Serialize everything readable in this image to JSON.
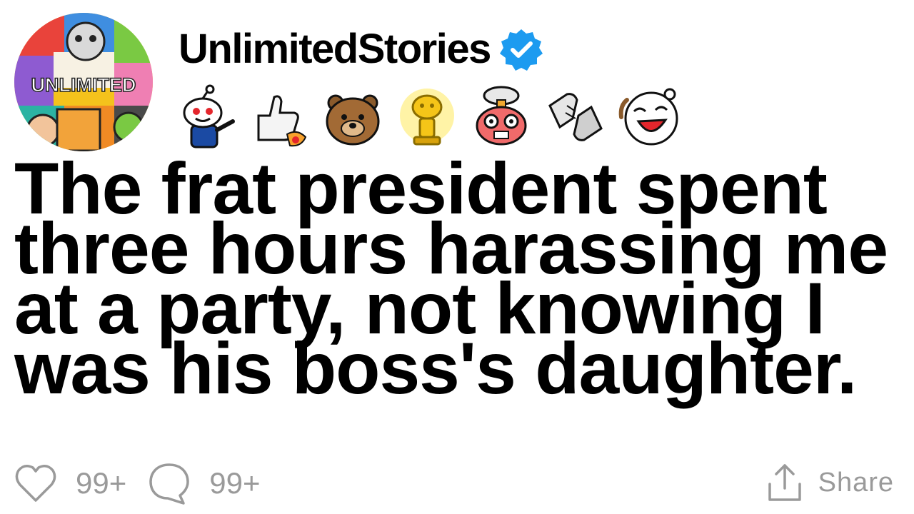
{
  "post": {
    "avatar_text": "UNLIMITED",
    "username": "UnlimitedStories",
    "verified_icon": "verified-check-icon",
    "awards": [
      {
        "icon": "reddit-alien-pointing-icon"
      },
      {
        "icon": "thumbs-up-rocket-icon"
      },
      {
        "icon": "bear-face-icon"
      },
      {
        "icon": "gold-trophy-icon"
      },
      {
        "icon": "mind-blown-icon"
      },
      {
        "icon": "handshake-icon"
      },
      {
        "icon": "laughing-face-icon"
      }
    ],
    "headline": "The frat president spent three hours harassing me at a party, not knowing I was his boss's daughter."
  },
  "actions": {
    "like_count": "99+",
    "comment_count": "99+",
    "share_label": "Share"
  },
  "colors": {
    "verified_blue": "#1d9bf0",
    "muted_gray": "#9a9a9a"
  }
}
